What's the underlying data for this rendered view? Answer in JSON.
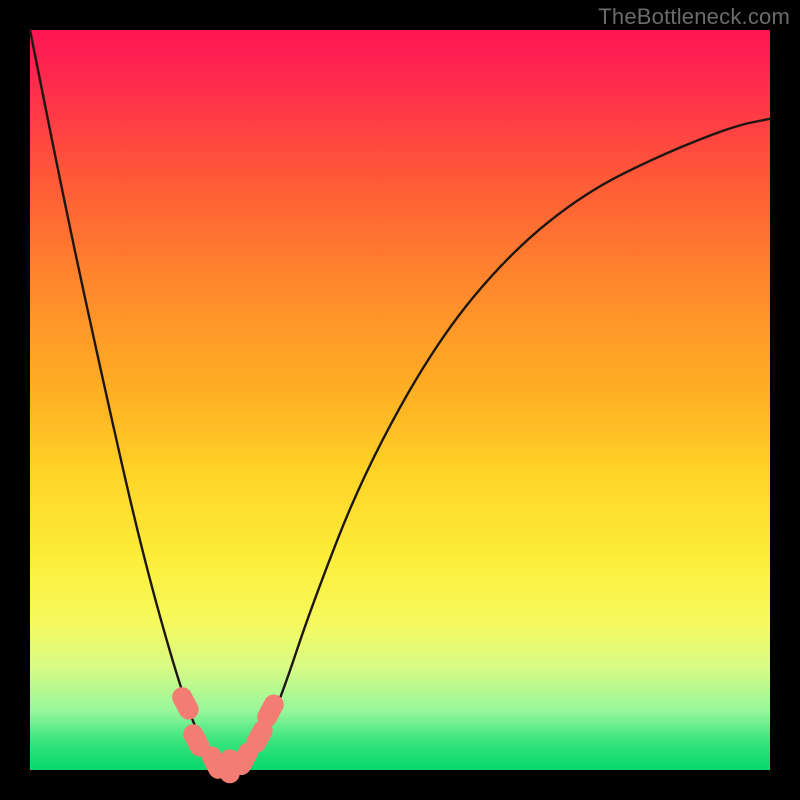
{
  "site_label": "TheBottleneck.com",
  "colors": {
    "frame_bg": "#000000",
    "gradient_top": "#ff1553",
    "gradient_bottom": "#05d86c",
    "curve_stroke": "#1d1611",
    "marker_fill": "#f37d73"
  },
  "chart_data": {
    "type": "line",
    "title": "",
    "xlabel": "",
    "ylabel": "",
    "xlim": [
      0,
      100
    ],
    "ylim": [
      0,
      100
    ],
    "series": [
      {
        "name": "bottleneck-curve",
        "x": [
          0,
          5,
          10,
          15,
          20,
          23,
          25,
          27,
          29,
          31,
          34,
          38,
          45,
          55,
          65,
          75,
          85,
          95,
          100
        ],
        "values": [
          100,
          75,
          52,
          30,
          12,
          4,
          1,
          0,
          0.5,
          3,
          10,
          22,
          40,
          58,
          70,
          78,
          83,
          87,
          88
        ]
      }
    ],
    "markers": [
      {
        "x": 21.0,
        "y": 9.0
      },
      {
        "x": 22.5,
        "y": 4.0
      },
      {
        "x": 25.0,
        "y": 1.0
      },
      {
        "x": 27.0,
        "y": 0.5
      },
      {
        "x": 29.0,
        "y": 1.5
      },
      {
        "x": 31.0,
        "y": 4.5
      },
      {
        "x": 32.5,
        "y": 8.0
      }
    ]
  }
}
